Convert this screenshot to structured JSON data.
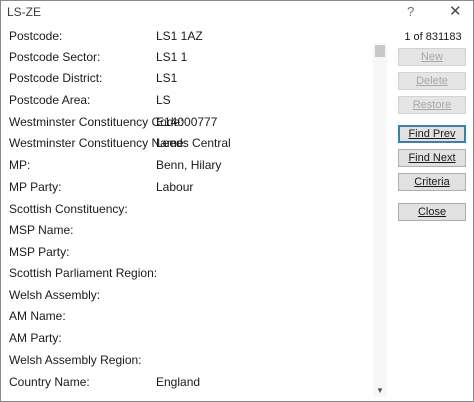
{
  "window": {
    "title": "LS-ZE",
    "help_glyph": "?",
    "close_glyph": "✕"
  },
  "fields": [
    {
      "label": "Postcode:",
      "value": "LS1 1AZ"
    },
    {
      "label": "Postcode Sector:",
      "value": "LS1 1"
    },
    {
      "label": "Postcode District:",
      "value": "LS1"
    },
    {
      "label": "Postcode Area:",
      "value": "LS"
    },
    {
      "label": "Westminster Constituency Code:",
      "value": "E14000777"
    },
    {
      "label": "Westminster Constituency Name:",
      "value": "Leeds Central"
    },
    {
      "label": "MP:",
      "value": "Benn, Hilary"
    },
    {
      "label": "MP Party:",
      "value": "Labour"
    },
    {
      "label": "Scottish Constituency:",
      "value": ""
    },
    {
      "label": "MSP Name:",
      "value": ""
    },
    {
      "label": "MSP Party:",
      "value": ""
    },
    {
      "label": "Scottish Parliament Region:",
      "value": ""
    },
    {
      "label": "Welsh Assembly:",
      "value": ""
    },
    {
      "label": "AM Name:",
      "value": ""
    },
    {
      "label": "AM Party:",
      "value": ""
    },
    {
      "label": "Welsh Assembly Region:",
      "value": ""
    },
    {
      "label": "Country Name:",
      "value": "England"
    }
  ],
  "record_counter": "1 of 831183",
  "buttons": {
    "new": "New",
    "delete": "Delete",
    "restore": "Restore",
    "find_prev": "Find Prev",
    "find_next": "Find Next",
    "criteria": "Criteria",
    "close": "Close"
  },
  "scrollbar": {
    "up_glyph": "▲",
    "down_glyph": "▼"
  }
}
